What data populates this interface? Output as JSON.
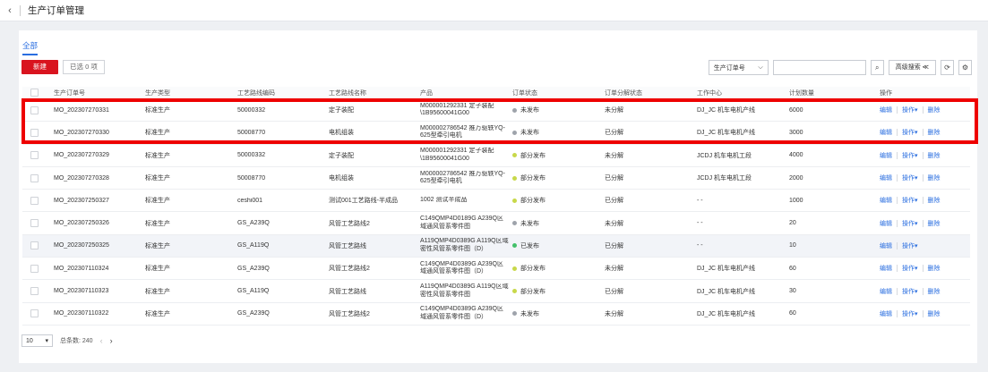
{
  "header": {
    "back_icon": "‹",
    "title": "生产订单管理"
  },
  "tabs": [
    {
      "label": "全部"
    }
  ],
  "toolbar": {
    "new_label": "新建",
    "selected_label": "已选 0 项",
    "search_field_select": "生产订单号",
    "search_placeholder": "",
    "search_icon": "⌕",
    "advanced_search_label": "高级搜索 ≪",
    "refresh_icon": "⟳",
    "settings_icon": "⚙"
  },
  "columns": [
    "生产订单号",
    "生产类型",
    "工艺路线编码",
    "工艺路线名称",
    "产品",
    "订单状态",
    "订单分解状态",
    "工作中心",
    "计划数量",
    "操作"
  ],
  "status_colors": {
    "未发布": "#9ea3ab",
    "部分发布": "#c8d84a",
    "已发布": "#43c06a"
  },
  "row_actions": {
    "edit": "编辑",
    "operate": "操作▾",
    "delete": "删除"
  },
  "rows": [
    {
      "order_no": "MO_202307270331",
      "type": "标准生产",
      "route_code": "50000332",
      "route_name": "定子装配",
      "product": "M000001292331 定子装配 \\1B95600041G00",
      "status": "未发布",
      "split": "未分解",
      "work_center": "DJ_JC 机车电机产线",
      "qty": "6000"
    },
    {
      "order_no": "MO_202307270330",
      "type": "标准生产",
      "route_code": "50008770",
      "route_name": "电机组装",
      "product": "M000002786542 推万驱轶YQ-625型牵引电机",
      "status": "未发布",
      "split": "已分解",
      "work_center": "DJ_JC 机车电机产线",
      "qty": "3000"
    },
    {
      "order_no": "MO_202307270329",
      "type": "标准生产",
      "route_code": "50000332",
      "route_name": "定子装配",
      "product": "M000001292331 定子装配 \\1B95600041G00",
      "status": "部分发布",
      "split": "未分解",
      "work_center": "JCDJ 机车电机工段",
      "qty": "4000"
    },
    {
      "order_no": "MO_202307270328",
      "type": "标准生产",
      "route_code": "50008770",
      "route_name": "电机组装",
      "product": "M000002786542 推万驱轶YQ-625型牵引电机",
      "status": "部分发布",
      "split": "已分解",
      "work_center": "JCDJ 机车电机工段",
      "qty": "2000"
    },
    {
      "order_no": "MO_202307250327",
      "type": "标准生产",
      "route_code": "ceshi001",
      "route_name": "测试001工艺路线-半成品",
      "product": "1002 测试半成品",
      "status": "部分发布",
      "split": "已分解",
      "work_center": "- -",
      "qty": "1000"
    },
    {
      "order_no": "MO_202307250326",
      "type": "标准生产",
      "route_code": "GS_A239Q",
      "route_name": "风管工艺路线2",
      "product": "C149QMP4D0189G A239Q区域通风管系零件图",
      "status": "未发布",
      "split": "未分解",
      "work_center": "- -",
      "qty": "20"
    },
    {
      "order_no": "MO_202307250325",
      "type": "标准生产",
      "route_code": "GS_A119Q",
      "route_name": "风管工艺路线",
      "product": "A119QMP4D0389G A119Q区域密性风管系零件图（D）",
      "status": "已发布",
      "split": "已分解",
      "work_center": "- -",
      "qty": "10"
    },
    {
      "order_no": "MO_202307110324",
      "type": "标准生产",
      "route_code": "GS_A239Q",
      "route_name": "风管工艺路线2",
      "product": "C149QMP4D0389G A239Q区域通风管系零件图（D）",
      "status": "部分发布",
      "split": "未分解",
      "work_center": "DJ_JC 机车电机产线",
      "qty": "60"
    },
    {
      "order_no": "MO_202307110323",
      "type": "标准生产",
      "route_code": "GS_A119Q",
      "route_name": "风管工艺路线",
      "product": "A119QMP4D0389G A119Q区域密性风管系零件图",
      "status": "部分发布",
      "split": "已分解",
      "work_center": "DJ_JC 机车电机产线",
      "qty": "30"
    },
    {
      "order_no": "MO_202307110322",
      "type": "标准生产",
      "route_code": "GS_A239Q",
      "route_name": "风管工艺路线2",
      "product": "C149QMP4D0389G A239Q区域通风管系零件图（D）",
      "status": "未发布",
      "split": "未分解",
      "work_center": "DJ_JC 机车电机产线",
      "qty": "60"
    }
  ],
  "pagination": {
    "page_size": "10",
    "total_label": "总条数: 240",
    "prev_icon": "‹",
    "next_icon": "›"
  }
}
